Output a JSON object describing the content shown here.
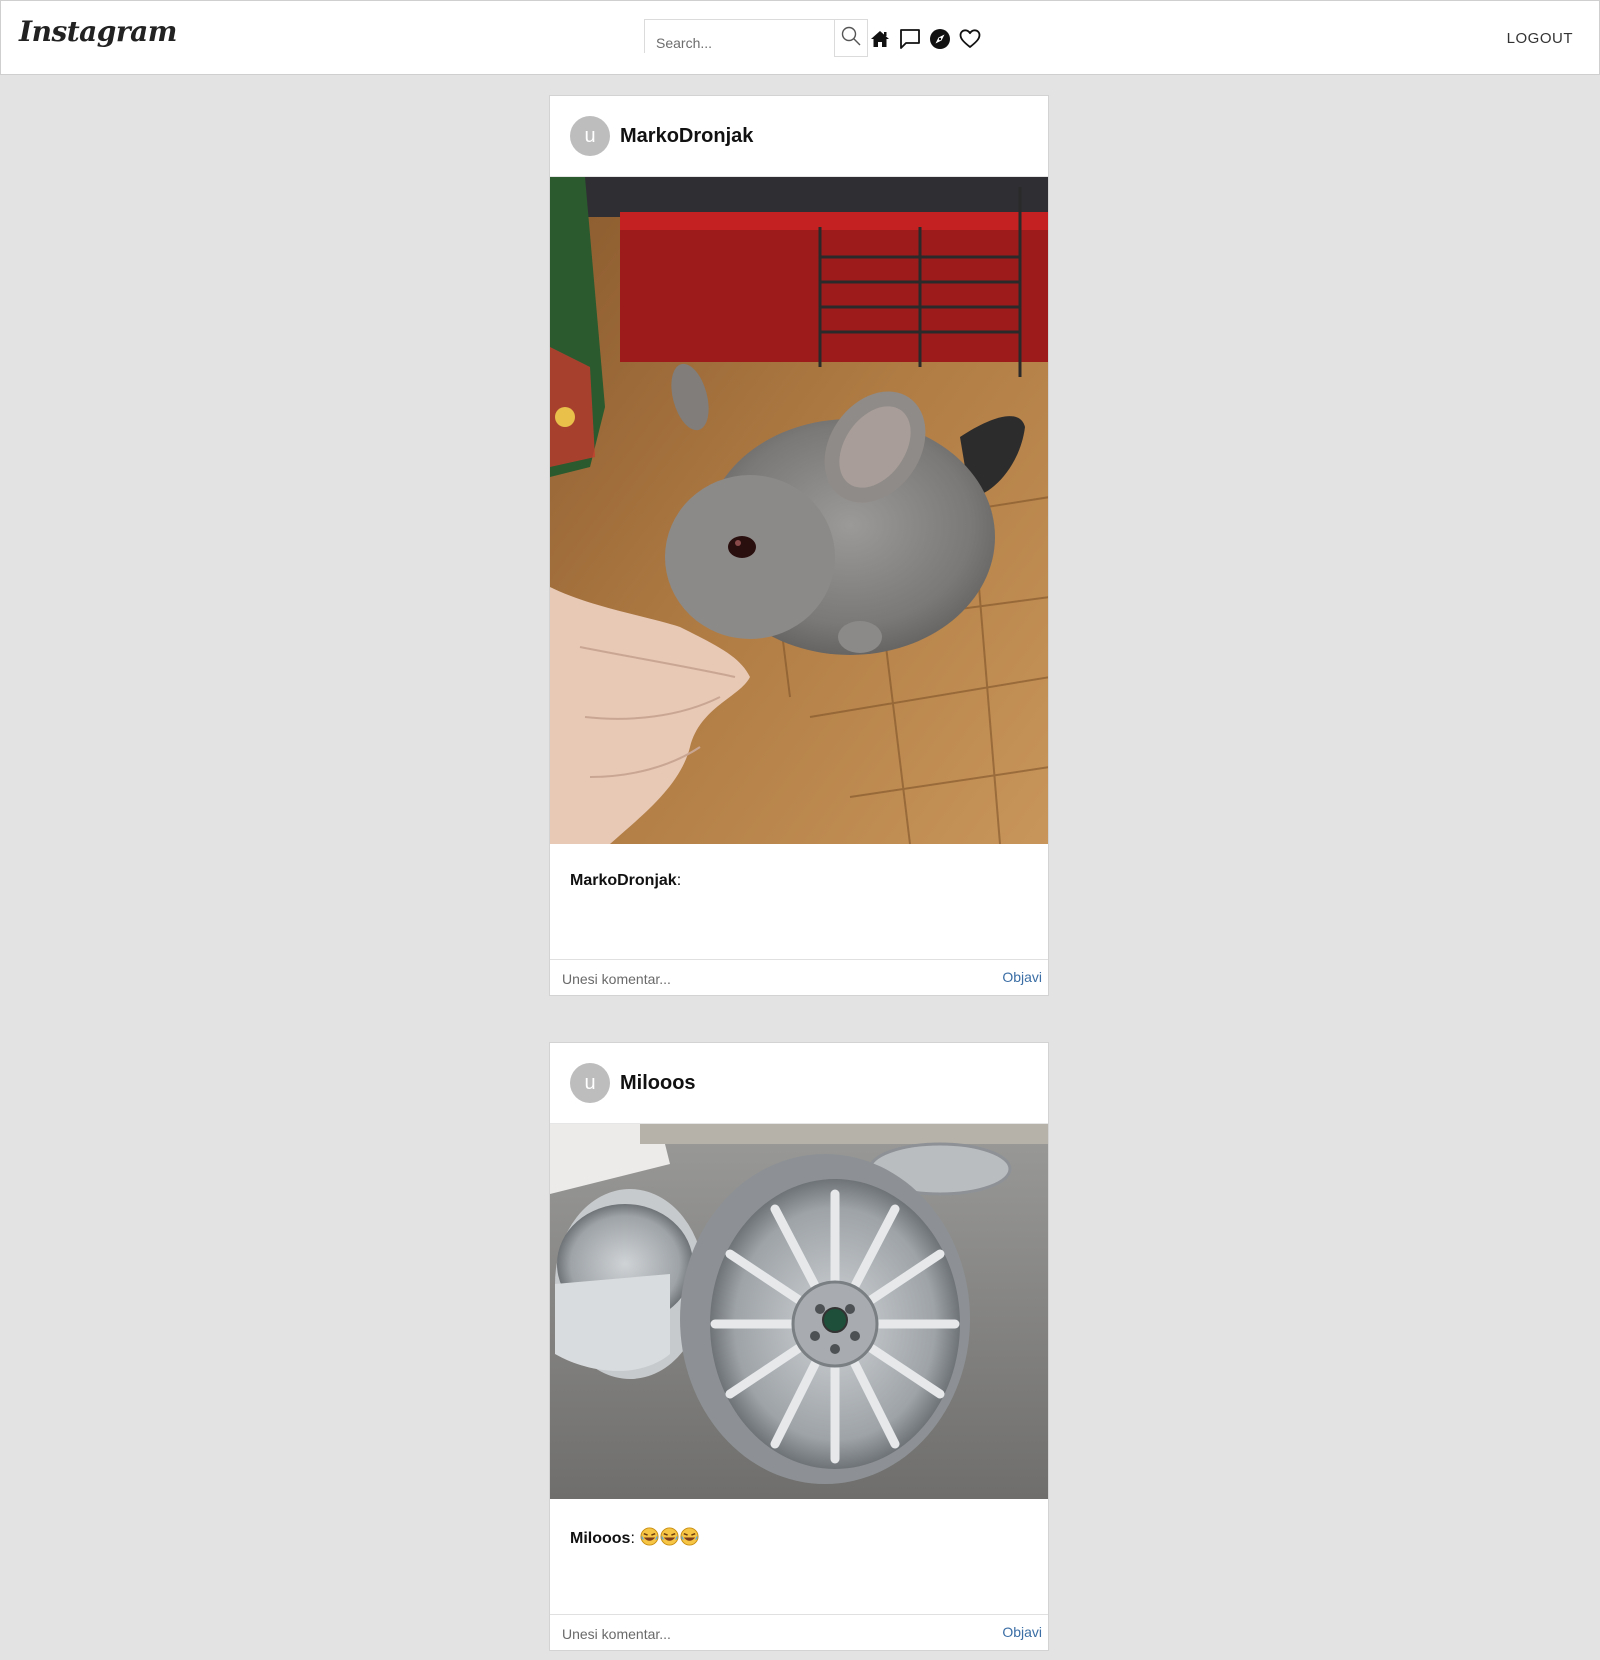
{
  "header": {
    "logo": "Instagram",
    "search": {
      "placeholder": "Search...",
      "value": ""
    },
    "icons": [
      "search-icon",
      "home-icon",
      "message-icon",
      "compass-icon",
      "heart-icon"
    ],
    "logout_label": "LOGOUT"
  },
  "posts": [
    {
      "avatar_letter": "u",
      "username": "MarkoDronjak",
      "photo_desc": "chinchilla on wooden floor sniffing a hand",
      "caption_user": "MarkoDronjak",
      "caption_sep": ":",
      "caption_text": "",
      "comment_placeholder": "Unesi komentar...",
      "post_label": "Objavi"
    },
    {
      "avatar_letter": "u",
      "username": "Milooos",
      "photo_desc": "silver alloy car wheel rims on concrete",
      "caption_user": "Milooos",
      "caption_sep": ":",
      "caption_text": "",
      "caption_emojis": [
        "laughing-emoji",
        "laughing-emoji",
        "laughing-emoji"
      ],
      "comment_placeholder": "Unesi komentar...",
      "post_label": "Objavi"
    }
  ],
  "colors": {
    "background": "#e3e3e3",
    "link": "#3b6ea5",
    "avatar": "#bdbdbd"
  }
}
